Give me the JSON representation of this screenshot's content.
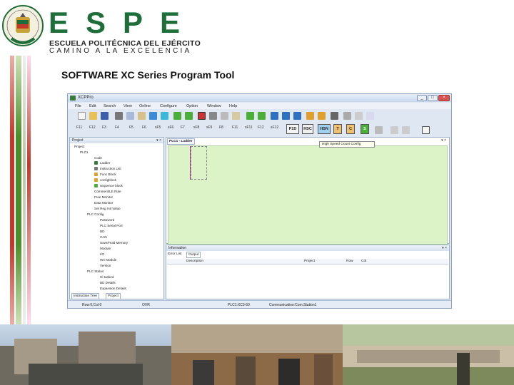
{
  "brand": {
    "acronym": "ESPE",
    "name": "ESCUELA POLITÉCNICA DEL EJÉRCITO",
    "motto": "CAMINO A LA EXCELENCIA"
  },
  "slide_title": "SOFTWARE XC Series Program Tool",
  "colors": {
    "brand_green": "#1e6e3a",
    "stripe_red": "#c0392b",
    "stripe_green": "#4a8f2a",
    "ladder_bg": "#dcf3c8"
  },
  "window": {
    "title": "XCPPro",
    "menu": [
      "File",
      "Edit",
      "Search",
      "View",
      "Online",
      "Configure",
      "Option",
      "Window",
      "Help"
    ],
    "fkeys": [
      "F11",
      "F12",
      "F3",
      "F4",
      "F5",
      "F6",
      "sF5",
      "sF6",
      "F7",
      "sF8",
      "sF9",
      "F8",
      "F11",
      "sF11",
      "F12",
      "sF12"
    ],
    "fboxes": [
      "P1D",
      "HSC",
      "HSN",
      "T",
      "C",
      "S"
    ],
    "project_panel": {
      "title": "Project",
      "tree": [
        "Project",
        "PLC1",
        "Code",
        "Ladder",
        "Instruction List",
        "Func Block",
        "configblock",
        "sequence block",
        "Comment/LE.Rule",
        "Free Monitor",
        "Data Monitor",
        "Set Reg Init Value",
        "PLC Config",
        "Password",
        "PLC Serial Port",
        "BD",
        "CAN",
        "Save/Hold Memory",
        "Module",
        "I/O",
        "WA Module",
        "Version",
        "PLC Status",
        "Hi-tasked",
        "BD Details",
        "Expansion Details"
      ],
      "tabs": [
        "Instruction Tree",
        "Project"
      ]
    },
    "ladder_tab": "PLC1 - Ladder",
    "tooltip": "High Speed Count Config",
    "info_panel": {
      "title": "Information",
      "tabs": [
        "Error List",
        "Output"
      ],
      "columns": [
        "Description",
        "Project",
        "Row",
        "Col"
      ]
    },
    "status": [
      "Row:0,Col:0",
      "OVR",
      "PLC1:XC3-60",
      "Communication:Com,Station1"
    ]
  }
}
